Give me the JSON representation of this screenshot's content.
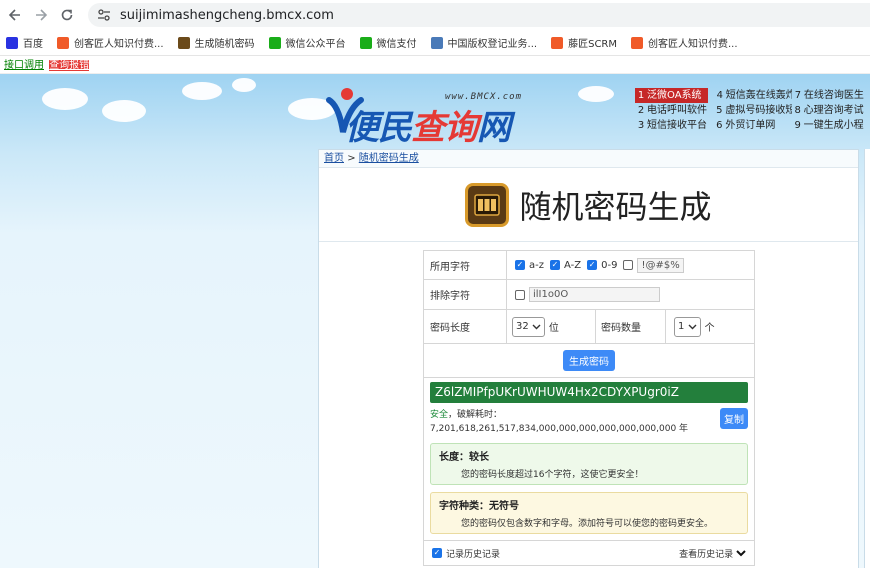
{
  "browser": {
    "url": "suijimimashengcheng.bmcx.com",
    "bookmarks": [
      {
        "label": "百度",
        "color": "#2932e1"
      },
      {
        "label": "创客匠人知识付费...",
        "color": "#f05a28"
      },
      {
        "label": "生成随机密码",
        "color": "#6b4a1a"
      },
      {
        "label": "微信公众平台",
        "color": "#1aad19"
      },
      {
        "label": "微信支付",
        "color": "#1aad19"
      },
      {
        "label": "中国版权登记业务...",
        "color": "#4a7ab8"
      },
      {
        "label": "藤匠SCRM",
        "color": "#f05a28"
      },
      {
        "label": "创客匠人知识付费...",
        "color": "#f05a28"
      }
    ]
  },
  "topstrip": {
    "link1": "接口调用",
    "link2": "查询报错"
  },
  "site": {
    "logo_url": "www.BMCX.com",
    "logo_blue": "便民",
    "logo_red": "查询",
    "logo_blue2": "网"
  },
  "ads": [
    [
      {
        "n": "1",
        "t": "泛微OA系统"
      },
      {
        "n": "4",
        "t": "短信轰在线轰炸"
      },
      {
        "n": "7",
        "t": "在线咨询医生"
      }
    ],
    [
      {
        "n": "2",
        "t": "电话呼叫软件"
      },
      {
        "n": "5",
        "t": "虚拟号码接收短"
      },
      {
        "n": "8",
        "t": "心理咨询考试"
      }
    ],
    [
      {
        "n": "3",
        "t": "短信接收平台"
      },
      {
        "n": "6",
        "t": "外贸订单网"
      },
      {
        "n": "9",
        "t": "一键生成小程"
      }
    ]
  ],
  "breadcrumb": {
    "home": "首页",
    "sep": ">",
    "current": "随机密码生成"
  },
  "page_title": "随机密码生成",
  "form": {
    "charset_label": "所用字符",
    "charset": [
      {
        "label": "a-z",
        "checked": true
      },
      {
        "label": "A-Z",
        "checked": true
      },
      {
        "label": "0-9",
        "checked": true
      },
      {
        "label": "!@#$%",
        "checked": false
      }
    ],
    "exclude_label": "排除字符",
    "exclude_value": "ilI1o0O",
    "length_label": "密码长度",
    "length_value": "32",
    "length_unit": "位",
    "count_label": "密码数量",
    "count_value": "1",
    "count_unit": "个",
    "generate_label": "生成密码"
  },
  "result": {
    "password": "Z6lZMIPfpUKrUWHUW4Hx2CDYXPUgr0iZ",
    "safety_level": "安全",
    "crack_time": "，破解耗时：7,201,618,261,517,834,000,000,000,000,000,000,000 年",
    "copy_label": "复制",
    "length_title": "长度：较长",
    "length_desc": "您的密码长度超过16个字符，这使它更安全！",
    "type_title": "字符种类：无符号",
    "type_desc": "您的密码仅包含数字和字母。添加符号可以使您的密码更安全。"
  },
  "history": {
    "record_label": "记录历史记录",
    "view_label": "查看历史记录"
  }
}
